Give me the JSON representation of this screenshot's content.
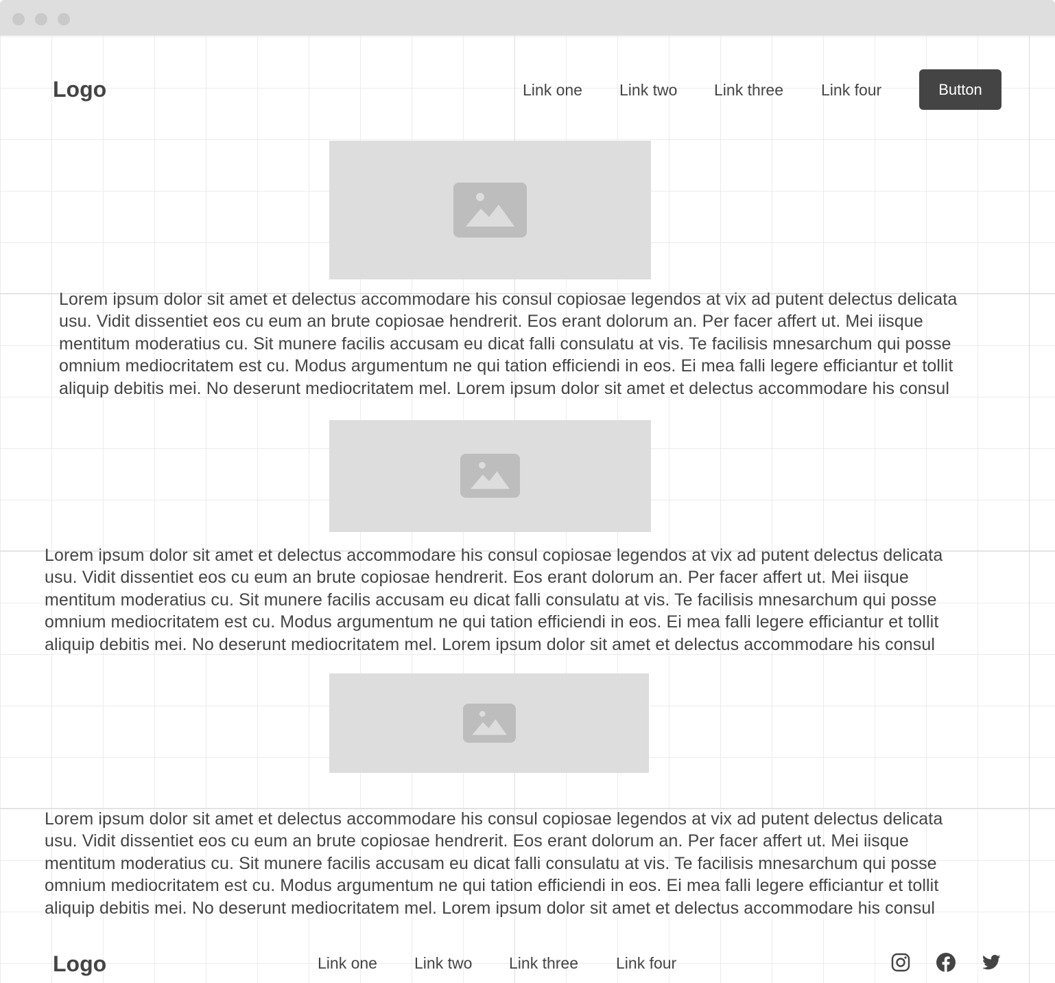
{
  "header": {
    "logo": "Logo",
    "nav": [
      {
        "label": "Link one"
      },
      {
        "label": "Link two"
      },
      {
        "label": "Link three"
      },
      {
        "label": "Link four"
      }
    ],
    "button_label": "Button"
  },
  "sections": [
    {
      "image_icon": "image-placeholder-icon",
      "paragraph_lines": [
        "Lorem ipsum dolor sit amet et delectus accommodare his consul copiosae legendos at vix ad putent delectus delicata",
        "usu. Vidit dissentiet eos cu eum an brute copiosae hendrerit. Eos erant dolorum an. Per facer affert ut. Mei iisque",
        "mentitum moderatius cu. Sit munere facilis accusam eu dicat falli consulatu at vis. Te facilisis mnesarchum qui posse",
        "omnium mediocritatem est cu. Modus argumentum ne qui tation efficiendi in eos. Ei mea falli legere efficiantur et tollit",
        "aliquip debitis mei. No deserunt mediocritatem mel. Lorem ipsum dolor sit amet et delectus accommodare his consul"
      ]
    },
    {
      "image_icon": "image-placeholder-icon",
      "paragraph_lines": [
        "Lorem ipsum dolor sit amet et delectus accommodare his consul copiosae legendos at vix ad putent delectus delicata",
        "usu. Vidit dissentiet eos cu eum an brute copiosae hendrerit. Eos erant dolorum an. Per facer affert ut. Mei iisque",
        "mentitum moderatius cu. Sit munere facilis accusam eu dicat falli consulatu at vis. Te facilisis mnesarchum qui posse",
        "omnium mediocritatem est cu. Modus argumentum ne qui tation efficiendi in eos. Ei mea falli legere efficiantur et tollit",
        "aliquip debitis mei. No deserunt mediocritatem mel. Lorem ipsum dolor sit amet et delectus accommodare his consul"
      ]
    },
    {
      "image_icon": "image-placeholder-icon",
      "paragraph_lines": [
        "Lorem ipsum dolor sit amet et delectus accommodare his consul copiosae legendos at vix ad putent delectus delicata",
        "usu. Vidit dissentiet eos cu eum an brute copiosae hendrerit. Eos erant dolorum an. Per facer affert ut. Mei iisque",
        "mentitum moderatius cu. Sit munere facilis accusam eu dicat falli consulatu at vis. Te facilisis mnesarchum qui posse",
        "omnium mediocritatem est cu. Modus argumentum ne qui tation efficiendi in eos. Ei mea falli legere efficiantur et tollit",
        "aliquip debitis mei. No deserunt mediocritatem mel. Lorem ipsum dolor sit amet et delectus accommodare his consul"
      ]
    }
  ],
  "footer": {
    "logo": "Logo",
    "nav": [
      {
        "label": "Link one"
      },
      {
        "label": "Link two"
      },
      {
        "label": "Link three"
      },
      {
        "label": "Link four"
      }
    ],
    "social": [
      "instagram-icon",
      "facebook-icon",
      "twitter-icon"
    ]
  },
  "colors": {
    "text": "#444444",
    "button_bg": "#444444",
    "button_text": "#ffffff",
    "placeholder_bg": "#dddddd",
    "placeholder_icon": "#bdbdbd",
    "titlebar": "#dedede",
    "grid": "#ececec"
  }
}
